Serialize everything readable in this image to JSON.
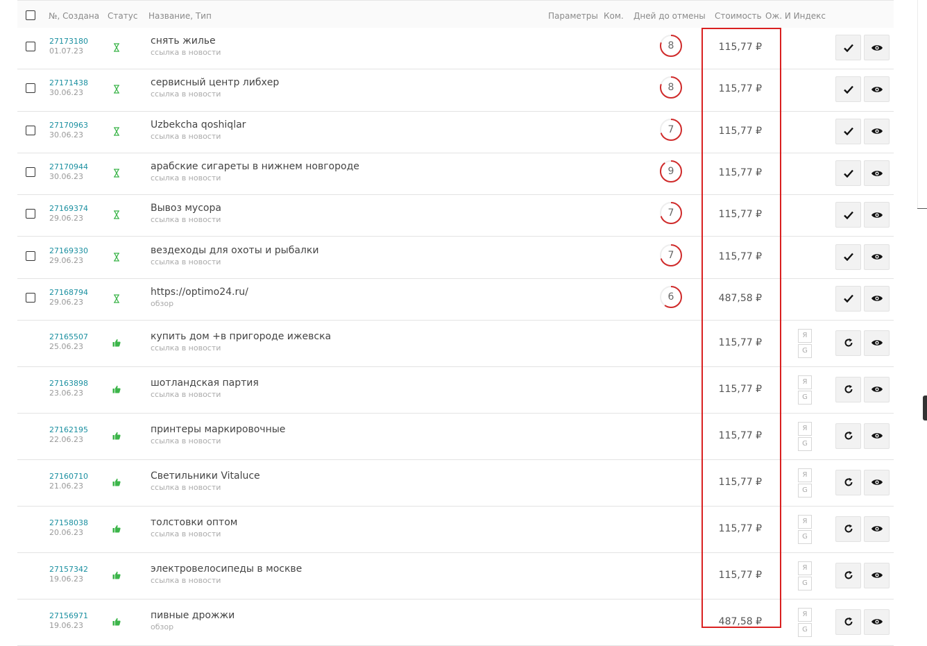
{
  "header": {
    "col_num": "№, Создана",
    "col_status": "Статус",
    "col_name": "Название, Тип",
    "col_params": "Параметры",
    "col_comm": "Ком.",
    "col_days": "Дней до отмены",
    "col_cost": "Стоимость",
    "col_index": "Ож. И Индекс"
  },
  "index_labels": {
    "ya": "Я",
    "g": "G"
  },
  "colors": {
    "accent_link": "#1a8fa0",
    "status_ok": "#3cb54a",
    "countdown": "#d02a2a",
    "highlight": "#d92020"
  },
  "rows": [
    {
      "num": "27173180",
      "date": "01.07.23",
      "status": "hourglass-icon",
      "name": "снять жилье",
      "type": "ссылка в новости",
      "days": "8",
      "cost": "115,77 ₽",
      "pending": true
    },
    {
      "num": "27171438",
      "date": "30.06.23",
      "status": "hourglass-icon",
      "name": "сервисный центр либхер",
      "type": "ссылка в новости",
      "days": "8",
      "cost": "115,77 ₽",
      "pending": true
    },
    {
      "num": "27170963",
      "date": "30.06.23",
      "status": "hourglass-icon",
      "name": "Uzbekcha qoshiqlar",
      "type": "ссылка в новости",
      "days": "7",
      "cost": "115,77 ₽",
      "pending": true
    },
    {
      "num": "27170944",
      "date": "30.06.23",
      "status": "hourglass-icon",
      "name": "арабские сигареты в нижнем новгороде",
      "type": "ссылка в новости",
      "days": "9",
      "cost": "115,77 ₽",
      "pending": true
    },
    {
      "num": "27169374",
      "date": "29.06.23",
      "status": "hourglass-icon",
      "name": "Вывоз мусора",
      "type": "ссылка в новости",
      "days": "7",
      "cost": "115,77 ₽",
      "pending": true
    },
    {
      "num": "27169330",
      "date": "29.06.23",
      "status": "hourglass-icon",
      "name": "вездеходы для охоты и рыбалки",
      "type": "ссылка в новости",
      "days": "7",
      "cost": "115,77 ₽",
      "pending": true
    },
    {
      "num": "27168794",
      "date": "29.06.23",
      "status": "hourglass-icon",
      "name": "https://optimo24.ru/",
      "type": "обзор",
      "days": "6",
      "cost": "487,58 ₽",
      "pending": true
    },
    {
      "num": "27165507",
      "date": "25.06.23",
      "status": "thumbs-up-icon",
      "name": "купить дом +в пригороде ижевска",
      "type": "ссылка в новости",
      "days": "",
      "cost": "115,77 ₽",
      "pending": false
    },
    {
      "num": "27163898",
      "date": "23.06.23",
      "status": "thumbs-up-icon",
      "name": "шотландская партия",
      "type": "ссылка в новости",
      "days": "",
      "cost": "115,77 ₽",
      "pending": false
    },
    {
      "num": "27162195",
      "date": "22.06.23",
      "status": "thumbs-up-icon",
      "name": "принтеры маркировочные",
      "type": "ссылка в новости",
      "days": "",
      "cost": "115,77 ₽",
      "pending": false
    },
    {
      "num": "27160710",
      "date": "21.06.23",
      "status": "thumbs-up-icon",
      "name": "Светильники Vitaluce",
      "type": "ссылка в новости",
      "days": "",
      "cost": "115,77 ₽",
      "pending": false
    },
    {
      "num": "27158038",
      "date": "20.06.23",
      "status": "thumbs-up-icon",
      "name": "толстовки оптом",
      "type": "ссылка в новости",
      "days": "",
      "cost": "115,77 ₽",
      "pending": false
    },
    {
      "num": "27157342",
      "date": "19.06.23",
      "status": "thumbs-up-icon",
      "name": "электровелосипеды в москве",
      "type": "ссылка в новости",
      "days": "",
      "cost": "115,77 ₽",
      "pending": false
    },
    {
      "num": "27156971",
      "date": "19.06.23",
      "status": "thumbs-up-icon",
      "name": "пивные дрожжи",
      "type": "обзор",
      "days": "",
      "cost": "487,58 ₽",
      "pending": false
    }
  ]
}
